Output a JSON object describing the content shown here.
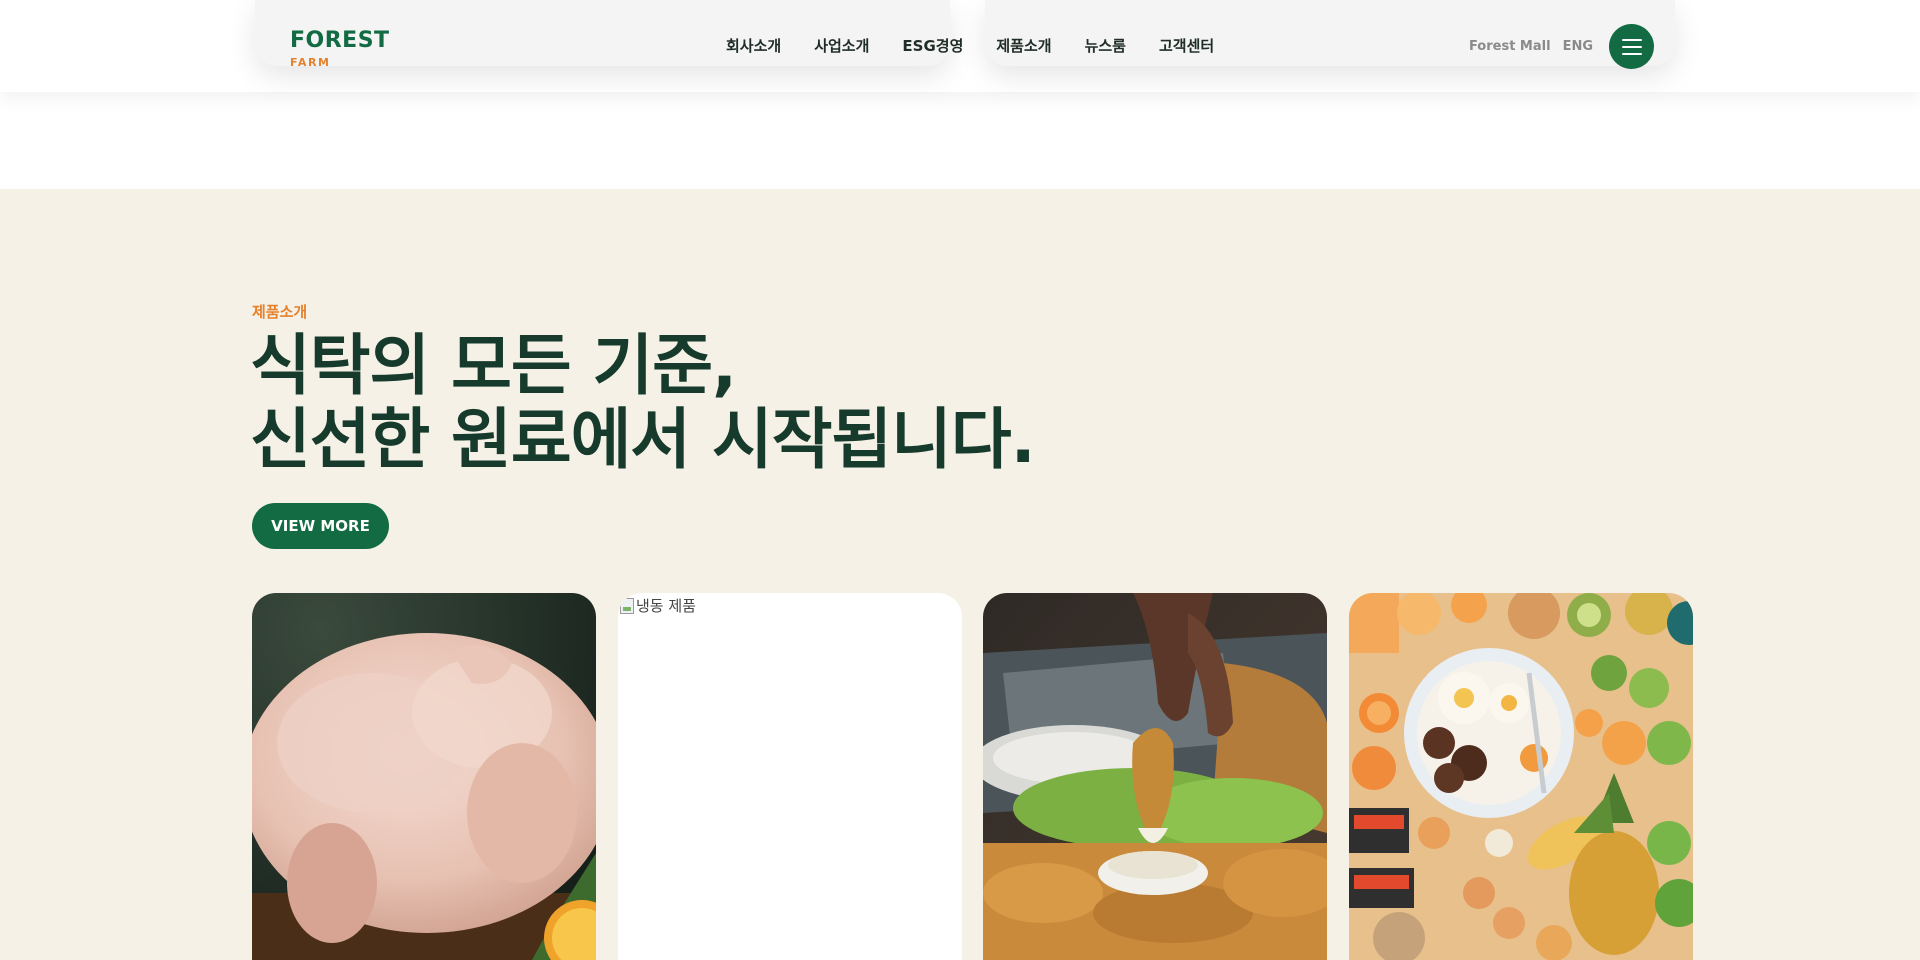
{
  "brand": {
    "name": "FOREST",
    "sub": "FARM"
  },
  "nav": {
    "items": [
      {
        "label": "회사소개"
      },
      {
        "label": "사업소개"
      },
      {
        "label": "ESG경영"
      },
      {
        "label": "제품소개"
      },
      {
        "label": "뉴스룸"
      },
      {
        "label": "고객센터"
      }
    ]
  },
  "utility": {
    "mall_label": "Forest Mall",
    "lang_label": "ENG",
    "menu_icon": "hamburger-menu-icon"
  },
  "products": {
    "eyebrow": "제품소개",
    "headline_line1": "식탁의 모든 기준,",
    "headline_line2": "신선한 원료에서 시작됩니다.",
    "cta_label": "VIEW MORE",
    "cards": [
      {
        "image": "raw-chicken-image"
      },
      {
        "image": "broken-image-icon",
        "alt": "냉동 제품"
      },
      {
        "image": "fried-chicken-dip-image"
      },
      {
        "image": "food-spread-image"
      }
    ]
  },
  "colors": {
    "brand_green": "#126b42",
    "accent_orange": "#e4822d",
    "headline_dark_green": "#163b2c",
    "section_cream": "#f6f1e7"
  }
}
